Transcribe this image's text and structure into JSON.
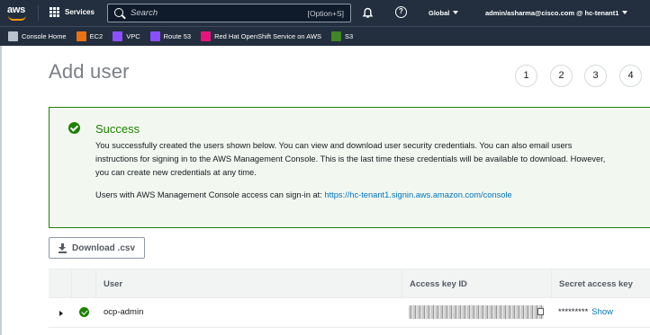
{
  "topnav": {
    "logo_text": "aws",
    "services_label": "Services",
    "search_placeholder": "Search",
    "search_shortcut": "[Option+S]",
    "region_label": "Global",
    "account_label": "admin/asharma@cisco.com @ hc-tenant1"
  },
  "favorites": [
    {
      "label": "Console Home",
      "icon": "console-home-icon"
    },
    {
      "label": "EC2",
      "icon": "ec2-icon"
    },
    {
      "label": "VPC",
      "icon": "vpc-icon"
    },
    {
      "label": "Route 53",
      "icon": "route53-icon"
    },
    {
      "label": "Red Hat OpenShift Service on AWS",
      "icon": "rosa-icon"
    },
    {
      "label": "S3",
      "icon": "s3-icon"
    }
  ],
  "page": {
    "title": "Add user",
    "steps": [
      "1",
      "2",
      "3",
      "4"
    ]
  },
  "alert": {
    "title": "Success",
    "body_lines": [
      "You successfully created the users shown below. You can view and download user security credentials. You can also email users",
      "instructions for signing in to the AWS Management Console. This is the last time these credentials will be available to download. However,",
      "you can create new credentials at any time."
    ],
    "signin_text": "Users with AWS Management Console access can sign-in at: ",
    "signin_url": "https://hc-tenant1.signin.aws.amazon.com/console"
  },
  "download_button": "Download .csv",
  "table": {
    "headers": [
      "User",
      "Access key ID",
      "Secret access key"
    ],
    "rows": [
      {
        "user": "ocp-admin",
        "secret": "*********",
        "show": "Show"
      }
    ]
  },
  "colors": {
    "nav_bg": "#232f3e",
    "success": "#1d8102",
    "link": "#0073bb",
    "brand_orange": "#ff9900"
  }
}
